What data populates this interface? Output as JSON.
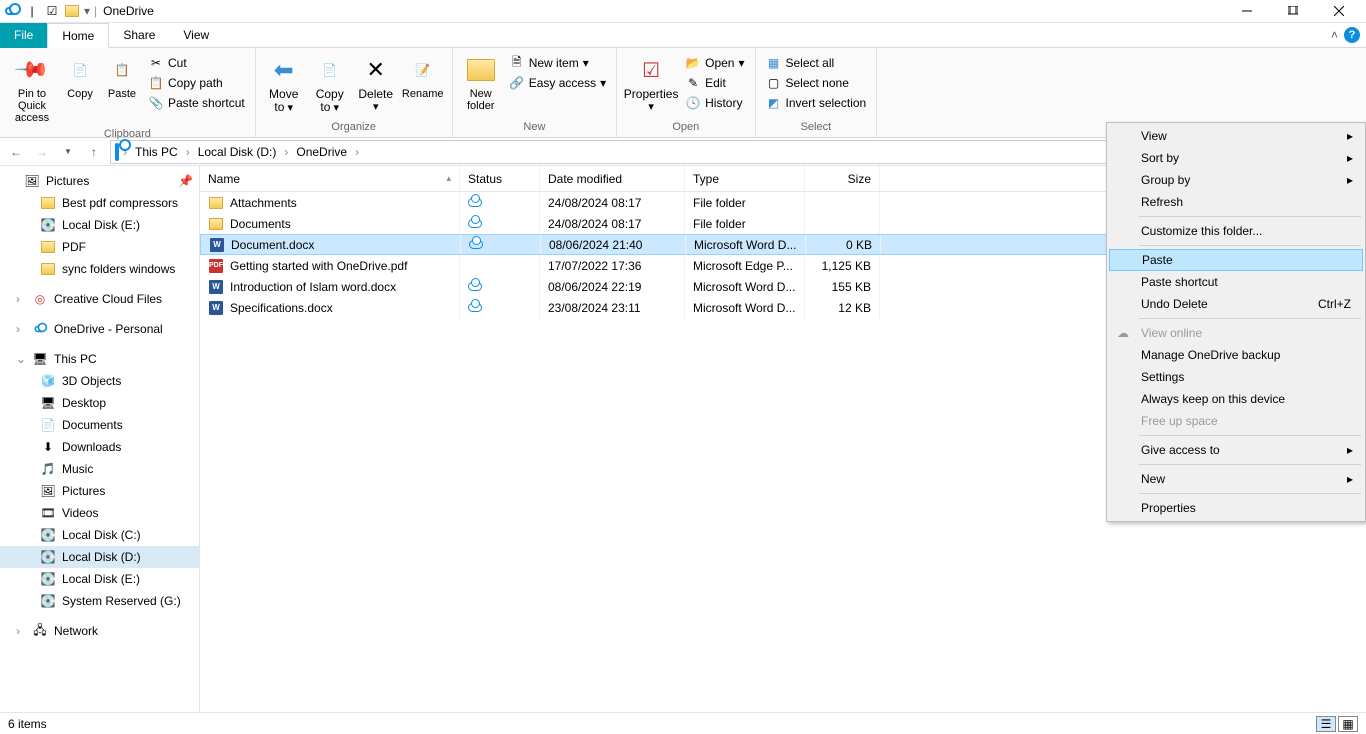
{
  "title": "OneDrive",
  "tabs": {
    "file": "File",
    "home": "Home",
    "share": "Share",
    "view": "View"
  },
  "ribbon": {
    "clipboard": {
      "label": "Clipboard",
      "pin": "Pin to Quick access",
      "copy": "Copy",
      "paste": "Paste",
      "cut": "Cut",
      "copypath": "Copy path",
      "pasteshortcut": "Paste shortcut"
    },
    "organize": {
      "label": "Organize",
      "moveTo": "Move to",
      "copyTo": "Copy to",
      "delete": "Delete",
      "rename": "Rename"
    },
    "new": {
      "label": "New",
      "newFolder": "New folder",
      "newItem": "New item",
      "easyAccess": "Easy access"
    },
    "open": {
      "label": "Open",
      "properties": "Properties",
      "open": "Open",
      "edit": "Edit",
      "history": "History"
    },
    "select": {
      "label": "Select",
      "selectAll": "Select all",
      "selectNone": "Select none",
      "invert": "Invert selection"
    }
  },
  "breadcrumb": [
    "This PC",
    "Local Disk (D:)",
    "OneDrive"
  ],
  "columns": {
    "name": "Name",
    "status": "Status",
    "date": "Date modified",
    "type": "Type",
    "size": "Size"
  },
  "nav": {
    "pictures": "Pictures",
    "bestpdf": "Best pdf compressors",
    "localE1": "Local Disk (E:)",
    "pdf": "PDF",
    "sync": "sync folders windows",
    "creative": "Creative Cloud Files",
    "onedrive": "OneDrive - Personal",
    "thispc": "This PC",
    "threed": "3D Objects",
    "desktop": "Desktop",
    "documents": "Documents",
    "downloads": "Downloads",
    "music": "Music",
    "pictures2": "Pictures",
    "videos": "Videos",
    "localC": "Local Disk (C:)",
    "localD": "Local Disk (D:)",
    "localE": "Local Disk (E:)",
    "sysres": "System Reserved (G:)",
    "network": "Network"
  },
  "files": [
    {
      "icon": "folder",
      "name": "Attachments",
      "status": "cloud",
      "date": "24/08/2024 08:17",
      "type": "File folder",
      "size": ""
    },
    {
      "icon": "folder",
      "name": "Documents",
      "status": "cloud",
      "date": "24/08/2024 08:17",
      "type": "File folder",
      "size": ""
    },
    {
      "icon": "word",
      "name": "Document.docx",
      "status": "cloud",
      "date": "08/06/2024 21:40",
      "type": "Microsoft Word D...",
      "size": "0 KB",
      "selected": true
    },
    {
      "icon": "pdf",
      "name": "Getting started with OneDrive.pdf",
      "status": "",
      "date": "17/07/2022 17:36",
      "type": "Microsoft Edge P...",
      "size": "1,125 KB"
    },
    {
      "icon": "word",
      "name": "Introduction of Islam word.docx",
      "status": "cloud",
      "date": "08/06/2024 22:19",
      "type": "Microsoft Word D...",
      "size": "155 KB"
    },
    {
      "icon": "word",
      "name": "Specifications.docx",
      "status": "cloud",
      "date": "23/08/2024 23:11",
      "type": "Microsoft Word D...",
      "size": "12 KB"
    }
  ],
  "status": {
    "items": "6 items"
  },
  "context": {
    "view": "View",
    "sortBy": "Sort by",
    "groupBy": "Group by",
    "refresh": "Refresh",
    "customize": "Customize this folder...",
    "paste": "Paste",
    "pasteShortcut": "Paste shortcut",
    "undoDelete": "Undo Delete",
    "undoShortcut": "Ctrl+Z",
    "viewOnline": "View online",
    "manageBackup": "Manage OneDrive backup",
    "settings": "Settings",
    "alwaysKeep": "Always keep on this device",
    "freeUp": "Free up space",
    "giveAccess": "Give access to",
    "new": "New",
    "properties": "Properties"
  }
}
